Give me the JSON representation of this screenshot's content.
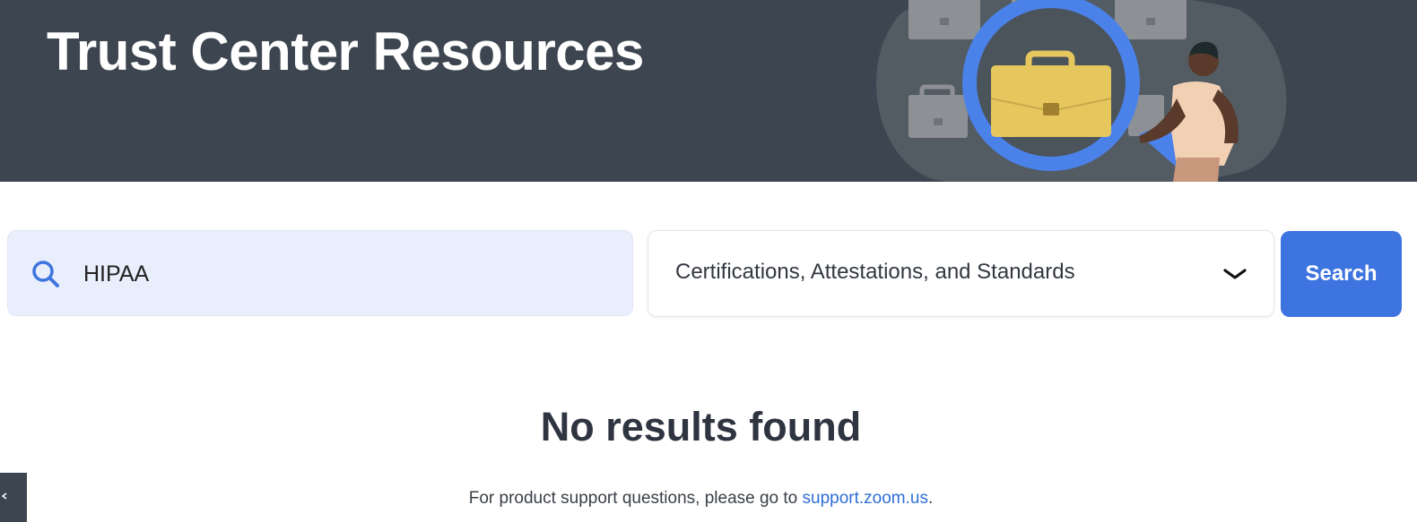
{
  "hero": {
    "title": "Trust Center Resources"
  },
  "search": {
    "value": "HIPAA",
    "icon": "search-icon"
  },
  "category": {
    "selected": "Certifications, Attestations, and Standards",
    "icon": "chevron-down-icon"
  },
  "search_button": {
    "label": "Search"
  },
  "results": {
    "empty_title": "No results found",
    "support_prefix": "For product support questions, please go to ",
    "support_link": "support.zoom.us",
    "support_suffix": "."
  },
  "colors": {
    "hero_bg": "#3d4650",
    "accent": "#3e74e0",
    "search_bg": "#e8eefb",
    "link": "#2f6fd6"
  }
}
